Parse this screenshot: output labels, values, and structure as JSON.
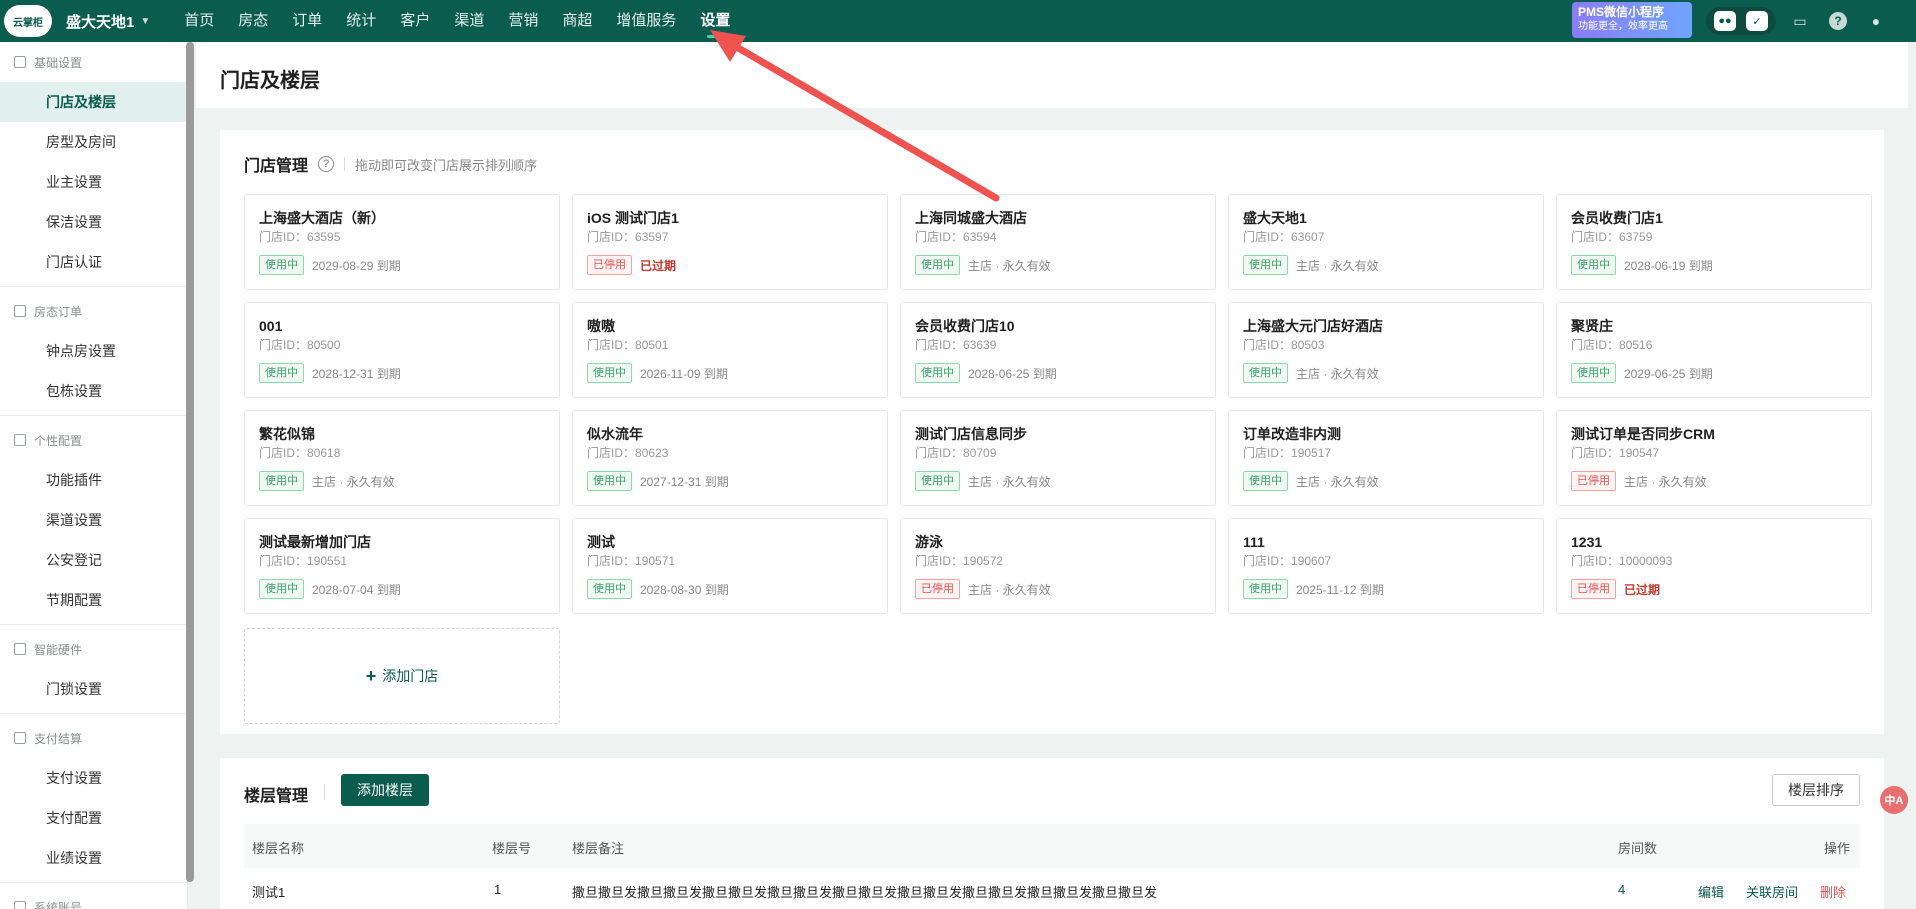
{
  "topbar": {
    "logo_text": "云掌柜",
    "brand": "盛大天地1",
    "nav": [
      "首页",
      "房态",
      "订单",
      "统计",
      "客户",
      "渠道",
      "营销",
      "商超",
      "增值服务",
      "设置"
    ],
    "active_nav": "设置",
    "promo_line1": "PMS微信小程序",
    "promo_line2": "功能更全，效率更高"
  },
  "sidebar": {
    "groups": [
      {
        "title": "基础设置",
        "items": [
          "门店及楼层",
          "房型及房间",
          "业主设置",
          "保洁设置",
          "门店认证"
        ]
      },
      {
        "title": "房态订单",
        "items": [
          "钟点房设置",
          "包栋设置"
        ]
      },
      {
        "title": "个性配置",
        "items": [
          "功能插件",
          "渠道设置",
          "公安登记",
          "节期配置"
        ]
      },
      {
        "title": "智能硬件",
        "items": [
          "门锁设置"
        ]
      },
      {
        "title": "支付结算",
        "items": [
          "支付设置",
          "支付配置",
          "业绩设置"
        ]
      },
      {
        "title": "系统账号",
        "items": []
      }
    ],
    "active_item": "门店及楼层"
  },
  "page": {
    "title": "门店及楼层"
  },
  "store_mgmt": {
    "title": "门店管理",
    "hint": "拖动即可改变门店展示排列顺序",
    "id_label": "门店ID：",
    "add_label": "添加门店",
    "stores": [
      {
        "name": "上海盛大酒店（新）",
        "id": "63595",
        "status": "使用中",
        "active": true,
        "expire": "2029-08-29 到期",
        "expired": false
      },
      {
        "name": "iOS 测试门店1",
        "id": "63597",
        "status": "已停用",
        "active": false,
        "expire": "已过期",
        "expired": true
      },
      {
        "name": "上海同城盛大酒店",
        "id": "63594",
        "status": "使用中",
        "active": true,
        "expire": "主店 · 永久有效",
        "expired": false
      },
      {
        "name": "盛大天地1",
        "id": "63607",
        "status": "使用中",
        "active": true,
        "expire": "主店 · 永久有效",
        "expired": false
      },
      {
        "name": "会员收费门店1",
        "id": "63759",
        "status": "使用中",
        "active": true,
        "expire": "2028-06-19 到期",
        "expired": false
      },
      {
        "name": "001",
        "id": "80500",
        "status": "使用中",
        "active": true,
        "expire": "2028-12-31 到期",
        "expired": false
      },
      {
        "name": "嗷嗷",
        "id": "80501",
        "status": "使用中",
        "active": true,
        "expire": "2026-11-09 到期",
        "expired": false
      },
      {
        "name": "会员收费门店10",
        "id": "63639",
        "status": "使用中",
        "active": true,
        "expire": "2028-06-25 到期",
        "expired": false
      },
      {
        "name": "上海盛大元门店好酒店",
        "id": "80503",
        "status": "使用中",
        "active": true,
        "expire": "主店 · 永久有效",
        "expired": false
      },
      {
        "name": "聚贤庄",
        "id": "80516",
        "status": "使用中",
        "active": true,
        "expire": "2029-06-25 到期",
        "expired": false
      },
      {
        "name": "繁花似锦",
        "id": "80618",
        "status": "使用中",
        "active": true,
        "expire": "主店 · 永久有效",
        "expired": false
      },
      {
        "name": "似水流年",
        "id": "80623",
        "status": "使用中",
        "active": true,
        "expire": "2027-12-31 到期",
        "expired": false
      },
      {
        "name": "测试门店信息同步",
        "id": "80709",
        "status": "使用中",
        "active": true,
        "expire": "主店 · 永久有效",
        "expired": false
      },
      {
        "name": "订单改造非内测",
        "id": "190517",
        "status": "使用中",
        "active": true,
        "expire": "主店 · 永久有效",
        "expired": false
      },
      {
        "name": "测试订单是否同步CRM",
        "id": "190547",
        "status": "已停用",
        "active": false,
        "expire": "主店 · 永久有效",
        "expired": false
      },
      {
        "name": "测试最新增加门店",
        "id": "190551",
        "status": "使用中",
        "active": true,
        "expire": "2028-07-04 到期",
        "expired": false
      },
      {
        "name": "测试",
        "id": "190571",
        "status": "使用中",
        "active": true,
        "expire": "2028-08-30 到期",
        "expired": false
      },
      {
        "name": "游泳",
        "id": "190572",
        "status": "已停用",
        "active": false,
        "expire": "主店 · 永久有效",
        "expired": false
      },
      {
        "name": "111",
        "id": "190607",
        "status": "使用中",
        "active": true,
        "expire": "2025-11-12 到期",
        "expired": false
      },
      {
        "name": "1231",
        "id": "10000093",
        "status": "已停用",
        "active": false,
        "expire": "已过期",
        "expired": true
      }
    ]
  },
  "floor_mgmt": {
    "title": "楼层管理",
    "add_button": "添加楼层",
    "sort_button": "楼层排序",
    "columns": {
      "name": "楼层名称",
      "number": "楼层号",
      "remark": "楼层备注",
      "rooms": "房间数",
      "ops": "操作"
    },
    "rows": [
      {
        "name": "测试1",
        "number": "1",
        "remark": "撒旦撒旦发撒旦撒旦发撒旦撒旦发撒旦撒旦发撒旦撒旦发撒旦撒旦发撒旦撒旦发撒旦撒旦发撒旦撒旦发",
        "rooms": "4",
        "edit": "编辑",
        "link": "关联房间",
        "delete": "删除"
      }
    ]
  },
  "fab": "中A",
  "colors": {
    "brand": "#0a5c4f",
    "accent": "#3fd6a6",
    "danger": "#e35353",
    "success": "#38a169",
    "annotation_arrow": "#f0524f"
  }
}
